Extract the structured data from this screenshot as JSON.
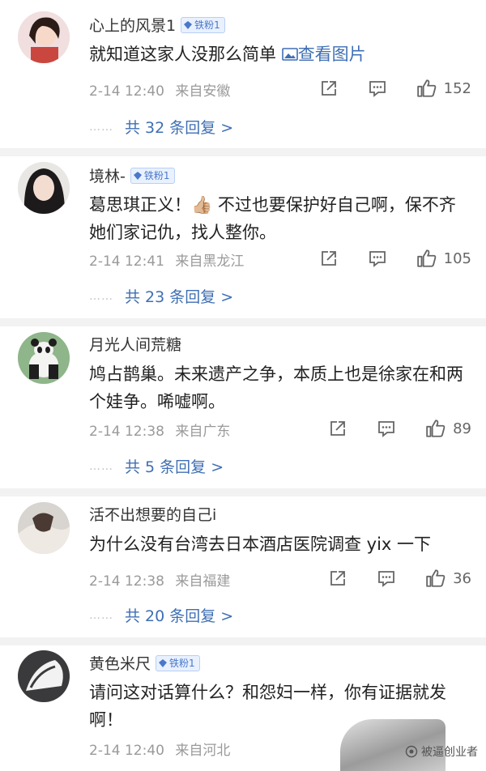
{
  "comments": [
    {
      "username": "心上的风景1",
      "badge": "铁粉1",
      "content": "就知道这家人没那么简单",
      "view_image": "查看图片",
      "date": "2-14 12:40",
      "location": "来自安徽",
      "likes": "152",
      "replies": "共 32 条回复 >"
    },
    {
      "username": "境林-",
      "badge": "铁粉1",
      "content": "葛思琪正义！👍🏼 不过也要保护好自己啊，保不齐她们家记仇，找人整你。",
      "date": "2-14 12:41",
      "location": "来自黑龙江",
      "likes": "105",
      "replies": "共 23 条回复 >"
    },
    {
      "username": "月光人间荒糖",
      "content": "鸠占鹊巢。未来遗产之争，本质上也是徐家在和两个娃争。唏嘘啊。",
      "date": "2-14 12:38",
      "location": "来自广东",
      "likes": "89",
      "replies": "共 5 条回复 >"
    },
    {
      "username": "活不出想要的自己i",
      "content": "为什么没有台湾去日本酒店医院调查 yix 一下",
      "date": "2-14 12:38",
      "location": "来自福建",
      "likes": "36",
      "replies": "共 20 条回复 >"
    },
    {
      "username": "黄色米尺",
      "badge": "铁粉1",
      "content": "请问这对话算什么？和怨妇一样，你有证据就发啊！",
      "date": "2-14 12:40",
      "location": "来自河北"
    }
  ],
  "reply_dots": "……",
  "watermark": "被逼创业者",
  "colors": {
    "link": "#3f6fb3",
    "meta": "#9a9a9a",
    "badge_bg": "#e9f1ff"
  }
}
